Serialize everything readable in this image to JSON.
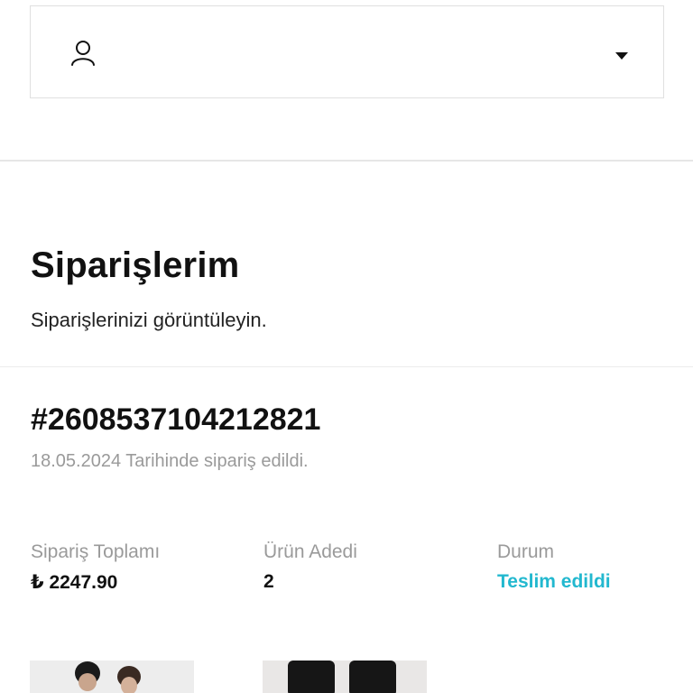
{
  "account_menu": {
    "user_icon": "user-icon",
    "caret_icon": "caret-down-icon"
  },
  "page": {
    "title": "Siparişlerim",
    "subtitle": "Siparişlerinizi görüntüleyin."
  },
  "order": {
    "number": "#2608537104212821",
    "date_text": "18.05.2024 Tarihinde sipariş edildi.",
    "summary": {
      "total_label": "Sipariş Toplamı",
      "total_value": "₺ 2247.90",
      "count_label": "Ürün Adedi",
      "count_value": "2",
      "status_label": "Durum",
      "status_value": "Teslim edildi"
    },
    "colors": {
      "status": "#22b8cf",
      "muted": "#9a9a9a",
      "text": "#111111"
    },
    "product_images": [
      "product-photo",
      "product-photo"
    ]
  }
}
